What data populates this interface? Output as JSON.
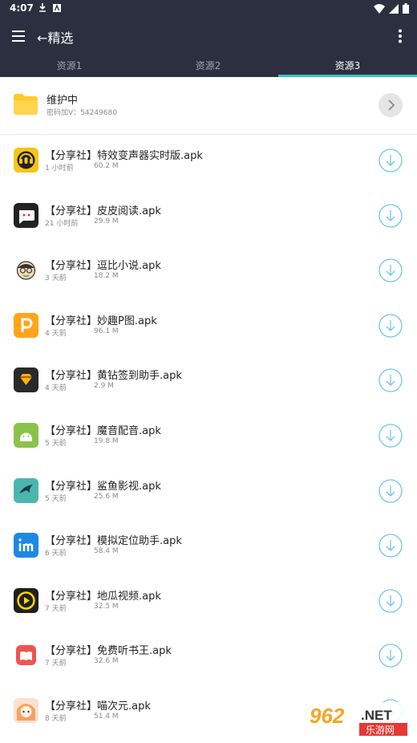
{
  "status": {
    "time": "4:07"
  },
  "appbar": {
    "title": "←精选"
  },
  "tabs": [
    {
      "label": "资源1"
    },
    {
      "label": "资源2"
    },
    {
      "label": "资源3"
    }
  ],
  "folder": {
    "title": "维护中",
    "subtitle": "密码加V：54249680"
  },
  "items": [
    {
      "name": "【分享社】特效变声器实时版.apk",
      "time": "1 小时前",
      "size": "60.2 M"
    },
    {
      "name": "【分享社】皮皮阅读.apk",
      "time": "21 小时前",
      "size": "29.9 M"
    },
    {
      "name": "【分享社】逗比小说.apk",
      "time": "3 天前",
      "size": "18.2 M"
    },
    {
      "name": "【分享社】妙趣P图.apk",
      "time": "4 天前",
      "size": "96.1 M"
    },
    {
      "name": "【分享社】黄钻签到助手.apk",
      "time": "4 天前",
      "size": "2.9 M"
    },
    {
      "name": "【分享社】魔音配音.apk",
      "time": "5 天前",
      "size": "19.8 M"
    },
    {
      "name": "【分享社】鲨鱼影视.apk",
      "time": "5 天前",
      "size": "25.6 M"
    },
    {
      "name": "【分享社】模拟定位助手.apk",
      "time": "6 天前",
      "size": "58.4 M"
    },
    {
      "name": "【分享社】地瓜视频.apk",
      "time": "7 天前",
      "size": "32.5 M"
    },
    {
      "name": "【分享社】免费听书王.apk",
      "time": "7 天前",
      "size": "32.6 M"
    },
    {
      "name": "【分享社】喵次元.apk",
      "time": "8 天前",
      "size": "51.4 M"
    }
  ],
  "watermark": {
    "num": "962",
    "net": ".NET",
    "cn": "乐游网"
  },
  "colors": {
    "bar": "#2b2f3f",
    "accent": "#2ec5c1",
    "download": "#6ec6e8"
  }
}
